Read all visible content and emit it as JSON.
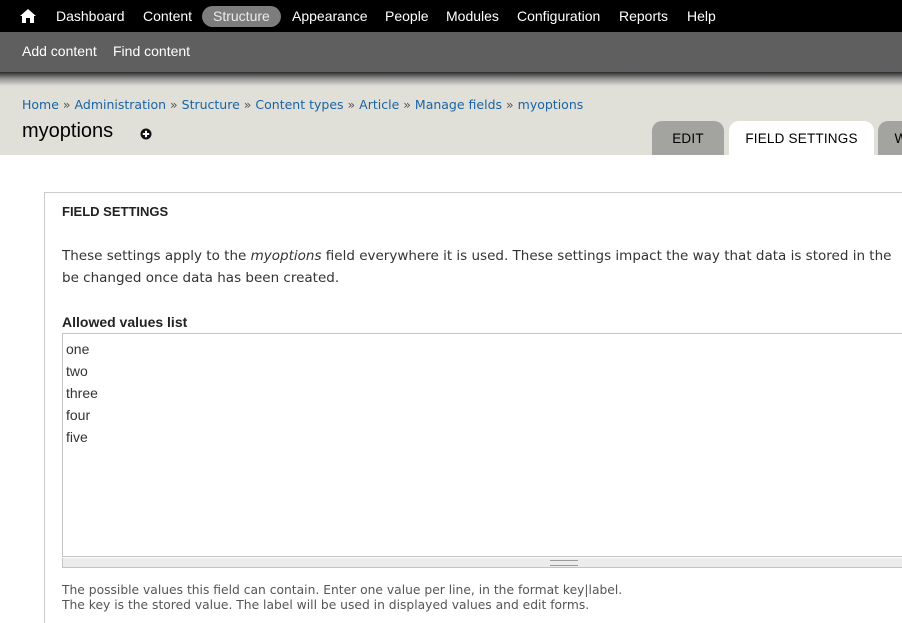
{
  "toolbar": {
    "home_icon": "home-icon",
    "items": [
      "Dashboard",
      "Content",
      "Structure",
      "Appearance",
      "People",
      "Modules",
      "Configuration",
      "Reports",
      "Help"
    ],
    "active_item": "Structure"
  },
  "shortcuts": [
    "Add content",
    "Find content"
  ],
  "breadcrumb": [
    "Home",
    "Administration",
    "Structure",
    "Content types",
    "Article",
    "Manage fields",
    "myoptions"
  ],
  "breadcrumb_separator": "»",
  "page": {
    "title": "myoptions",
    "shortcut_icon": "plus-circle-icon"
  },
  "tabs": [
    {
      "label": "EDIT",
      "active": false
    },
    {
      "label": "FIELD SETTINGS",
      "active": true
    },
    {
      "label": "W",
      "active": false
    }
  ],
  "fieldset": {
    "legend": "FIELD SETTINGS",
    "description_before": "These settings apply to the ",
    "description_field": "myoptions",
    "description_after": " field everywhere it is used. These settings impact the way that data is stored in the",
    "description_line2": "be changed once data has been created."
  },
  "allowed_values": {
    "label": "Allowed values list",
    "lines": [
      "one",
      "two",
      "three",
      "four",
      "five"
    ],
    "help_line1": "The possible values this field can contain. Enter one value per line, in the format key|label.",
    "help_line2": "The key is the stored value. The label will be used in displayed values and edit forms."
  },
  "colors": {
    "toolbar_bg": "#000000",
    "shortcuts_bg": "#5f5f5f",
    "header_bg": "#e0e0d8",
    "link": "#1b63a4",
    "active_pill": "#7d7d7d"
  }
}
